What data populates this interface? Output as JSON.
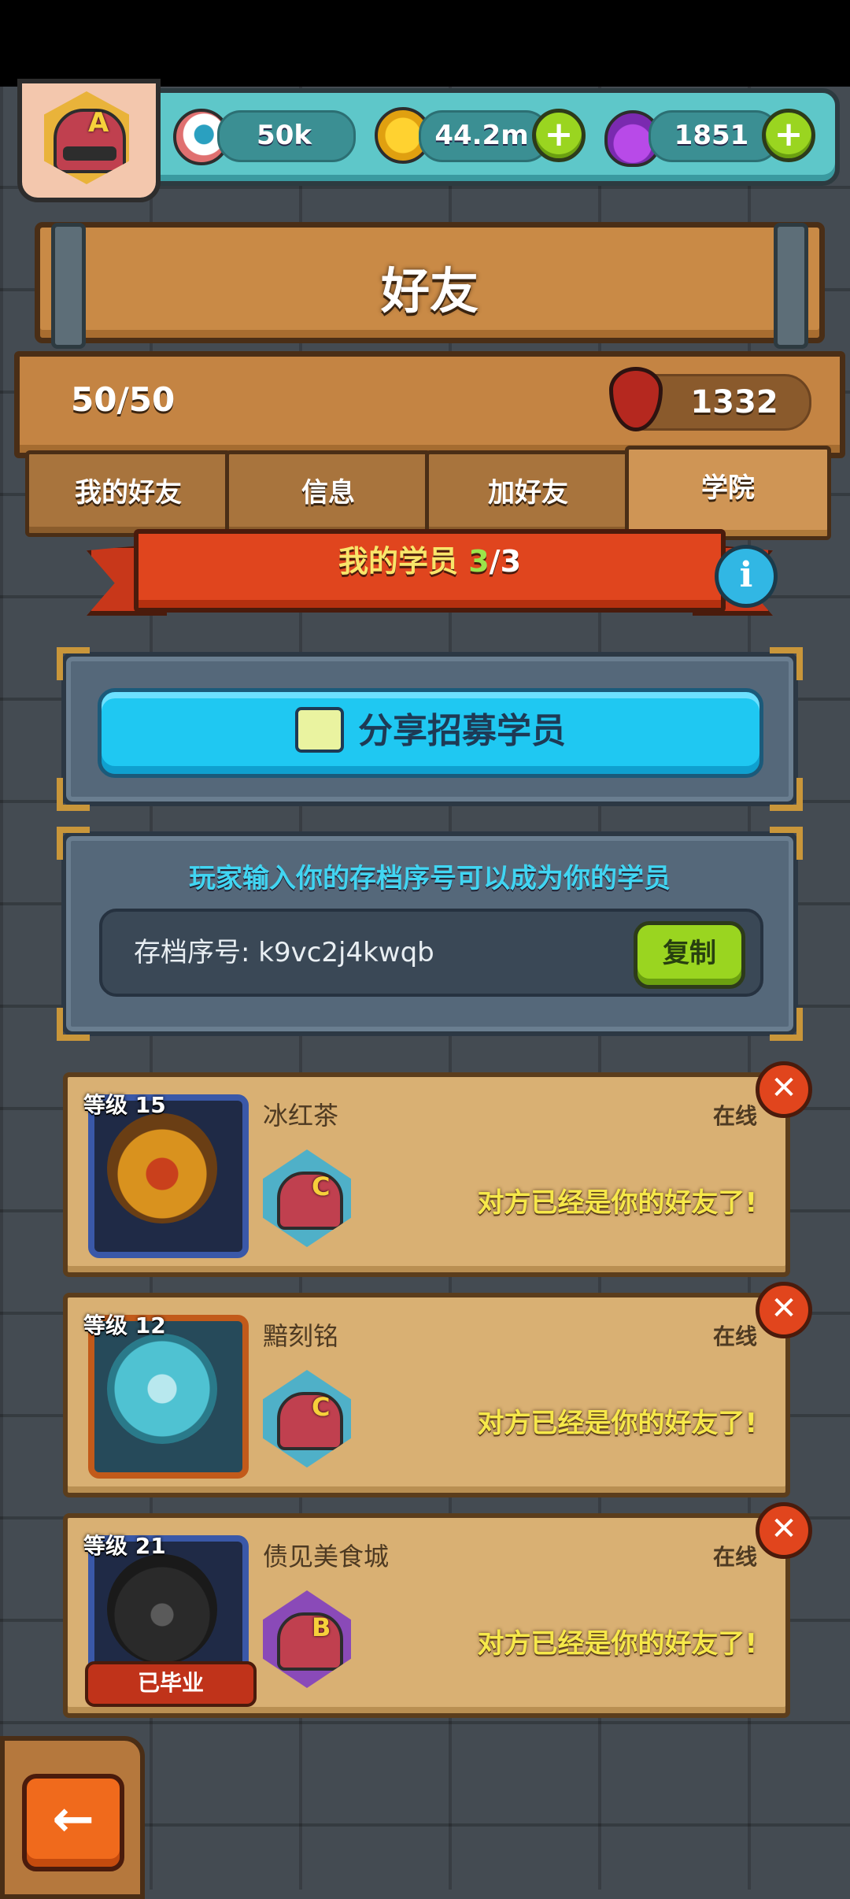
{
  "resources": {
    "eyeball": {
      "value": "50k",
      "icon": "eyeball-icon"
    },
    "coins": {
      "value": "44.2m",
      "icon": "gold-coin-icon"
    },
    "potion": {
      "value": "1851",
      "icon": "purple-potion-icon"
    },
    "add_symbol": "+"
  },
  "player_rank": {
    "letter": "A"
  },
  "title": "好友",
  "friends_count": "50/50",
  "blood": {
    "value": "1332",
    "icon": "blood-drop-icon"
  },
  "tabs": [
    {
      "label": "我的好友",
      "active": false
    },
    {
      "label": "信息",
      "active": false
    },
    {
      "label": "加好友",
      "active": false
    },
    {
      "label": "学院",
      "active": true
    }
  ],
  "banner": {
    "prefix": "我的学员 ",
    "count": "3",
    "separator": "/",
    "total": "3"
  },
  "info_symbol": "i",
  "share_button": "分享招募学员",
  "invite": {
    "description": "玩家输入你的存档序号可以成为你的学员",
    "code_label": "存档序号: k9vc2j4kwqb",
    "copy_button": "复制"
  },
  "students": [
    {
      "level": "等级 15",
      "name": "冰红茶",
      "status": "在线",
      "rank": "C",
      "message": "对方已经是你的好友了!",
      "graduated": null
    },
    {
      "level": "等级 12",
      "name": "黯刻铭",
      "status": "在线",
      "rank": "C",
      "message": "对方已经是你的好友了!",
      "graduated": null
    },
    {
      "level": "等级 21",
      "name": "债见美食城",
      "status": "在线",
      "rank": "B",
      "message": "对方已经是你的好友了!",
      "graduated": "已毕业"
    }
  ],
  "close_symbol": "✕",
  "back_symbol": "←",
  "colors": {
    "accent_green": "#9ad520",
    "banner_red": "#e0451e",
    "info_cyan": "#41d5f2"
  }
}
